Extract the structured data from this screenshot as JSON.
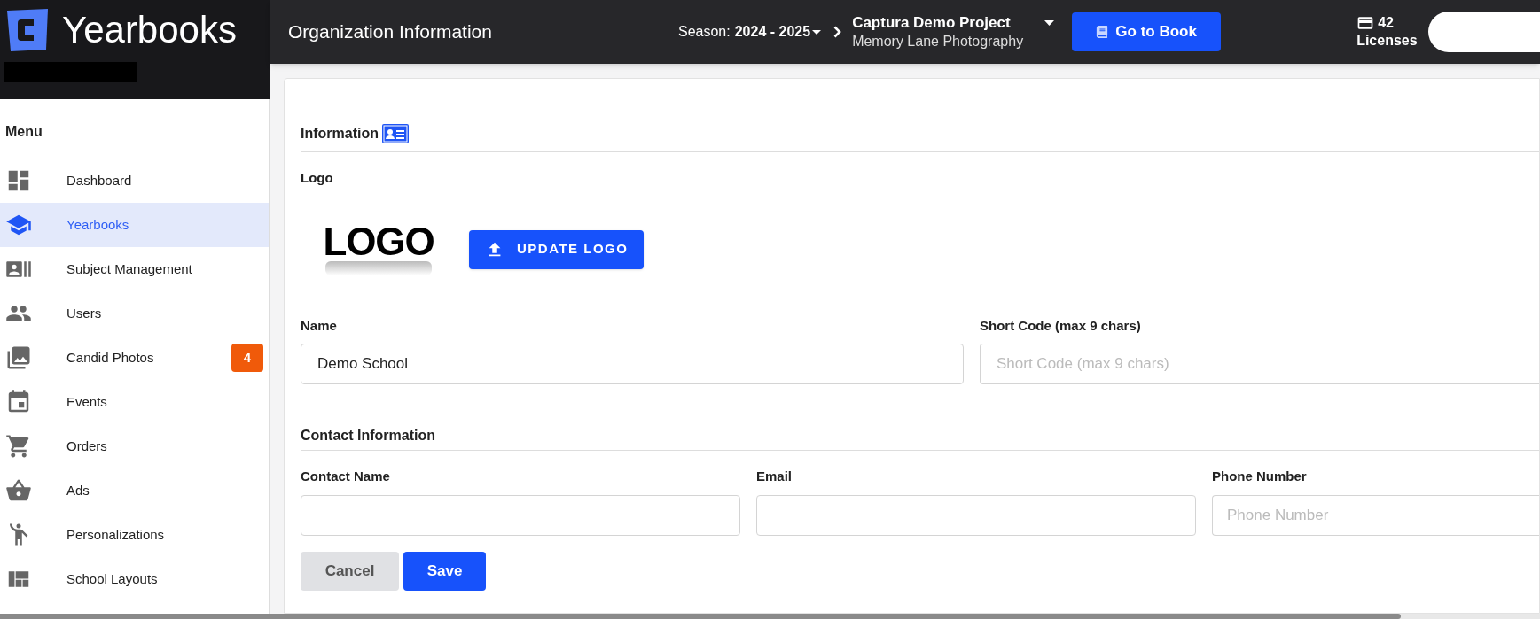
{
  "brand": {
    "name": "Yearbooks"
  },
  "header": {
    "title": "Organization Information",
    "season_label": "Season:",
    "season_value": "2024 - 2025",
    "project": "Captura Demo Project",
    "studio": "Memory Lane Photography",
    "go_button": "Go to Book",
    "licenses_count": "42",
    "licenses_label": "Licenses"
  },
  "sidebar": {
    "heading": "Menu",
    "items": [
      {
        "label": "Dashboard",
        "selected": false
      },
      {
        "label": "Yearbooks",
        "selected": true
      },
      {
        "label": "Subject Management",
        "selected": false
      },
      {
        "label": "Users",
        "selected": false
      },
      {
        "label": "Candid Photos",
        "selected": false,
        "badge": "4"
      },
      {
        "label": "Events",
        "selected": false
      },
      {
        "label": "Orders",
        "selected": false
      },
      {
        "label": "Ads",
        "selected": false
      },
      {
        "label": "Personalizations",
        "selected": false
      },
      {
        "label": "School Layouts",
        "selected": false
      }
    ]
  },
  "form": {
    "section_title": "Information",
    "logo_label": "Logo",
    "logo_image_text": "LOGO",
    "update_logo_button": "UPDATE LOGO",
    "name_label": "Name",
    "name_value": "Demo School",
    "short_code_label": "Short Code (max 9 chars)",
    "short_code_placeholder": "Short Code (max 9 chars)",
    "contact_title": "Contact Information",
    "contact_fields": [
      {
        "label": "Contact Name"
      },
      {
        "label": "Email"
      },
      {
        "label": "Phone Number",
        "placeholder": "Phone Number"
      }
    ],
    "cancel_button": "Cancel",
    "save_button": "Save"
  }
}
